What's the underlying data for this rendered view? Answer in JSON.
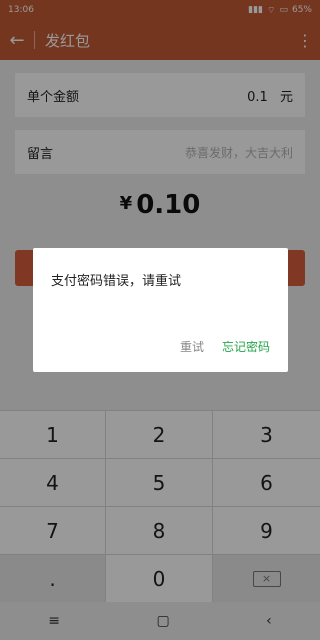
{
  "status": {
    "time": "13:06",
    "battery": "65%"
  },
  "appbar": {
    "back_icon": "arrow-left-icon",
    "title": "发红包",
    "more_icon": "more-vertical-icon"
  },
  "form": {
    "amount_label": "单个金额",
    "amount_value": "0.1",
    "amount_unit": "元",
    "message_label": "留言",
    "message_placeholder": "恭喜发财，大吉大利"
  },
  "amount_display": {
    "currency": "¥",
    "value": "0.10"
  },
  "dialog": {
    "message": "支付密码错误，请重试",
    "retry": "重试",
    "forgot": "忘记密码"
  },
  "keypad": {
    "keys": [
      "1",
      "2",
      "3",
      "4",
      "5",
      "6",
      "7",
      "8",
      "9",
      ".",
      "0"
    ],
    "delete_icon": "backspace-icon"
  },
  "colors": {
    "brand": "#c45a36",
    "accent_green": "#26a44a"
  }
}
